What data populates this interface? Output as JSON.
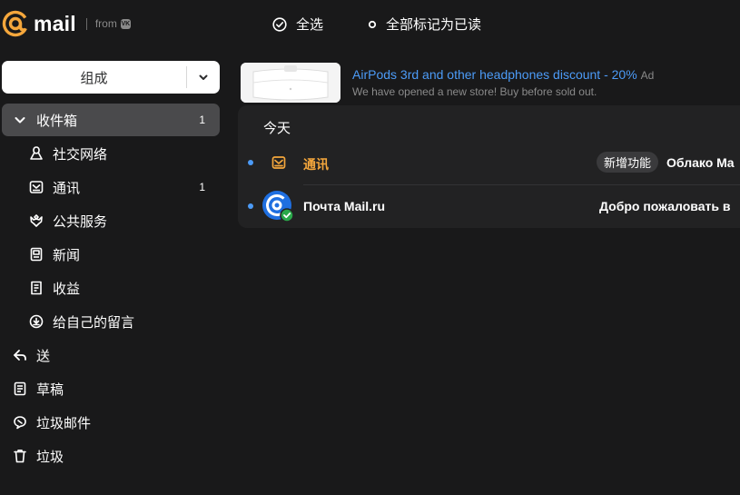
{
  "header": {
    "logo_text": "mail",
    "logo_from": "from",
    "vk_badge": "VK",
    "select_all": "全选",
    "mark_all_read": "全部标记为已读"
  },
  "sidebar": {
    "compose_label": "组成",
    "folders": [
      {
        "label": "收件箱",
        "count": "1",
        "icon": "chevron-down-icon"
      },
      {
        "label": "社交网络",
        "count": "",
        "icon": "social-icon"
      },
      {
        "label": "通讯",
        "count": "1",
        "icon": "newsletter-icon"
      },
      {
        "label": "公共服务",
        "count": "",
        "icon": "emblem-icon"
      },
      {
        "label": "新闻",
        "count": "",
        "icon": "news-icon"
      },
      {
        "label": "收益",
        "count": "",
        "icon": "receipt-icon"
      },
      {
        "label": "给自己的留言",
        "count": "",
        "icon": "inbox-arrow-icon"
      },
      {
        "label": "送",
        "count": "",
        "icon": "sent-icon"
      },
      {
        "label": "草稿",
        "count": "",
        "icon": "draft-icon"
      },
      {
        "label": "垃圾邮件",
        "count": "",
        "icon": "spam-icon"
      },
      {
        "label": "垃圾",
        "count": "",
        "icon": "trash-icon"
      }
    ]
  },
  "ad": {
    "title": "AirPods 3rd and other headphones discount - 20%",
    "label": "Ad",
    "description": "We have opened a new store! Buy before sold out."
  },
  "list": {
    "day_header": "今天",
    "messages": [
      {
        "sender": "通讯",
        "badge": "新增功能",
        "subject": "Облако Ma",
        "unread": true
      },
      {
        "sender": "Почта Mail.ru",
        "badge": "",
        "subject": "Добро пожаловать в",
        "unread": true
      }
    ]
  },
  "colors": {
    "background": "#19191a",
    "accent_orange": "#f5a73c",
    "link_blue": "#4c9bf7",
    "active_folder": "#4a4a4c",
    "list_background": "#222223"
  }
}
